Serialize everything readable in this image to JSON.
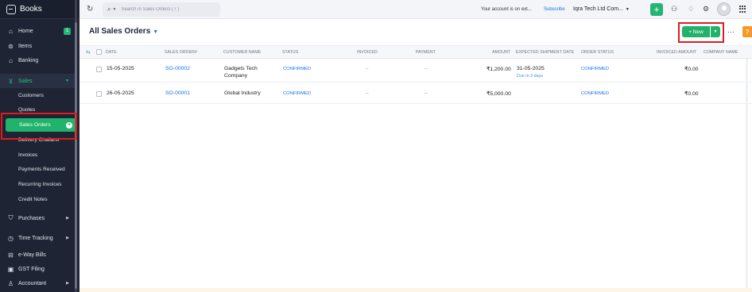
{
  "app": {
    "name": "Books"
  },
  "sidebar": {
    "home": "Home",
    "home_badge": "1",
    "items": "Items",
    "banking": "Banking",
    "sales": "Sales",
    "sales_sub": [
      "Customers",
      "Quotes",
      "Sales Orders",
      "Delivery Challans",
      "Invoices",
      "Payments Received",
      "Recurring Invoices",
      "Credit Notes"
    ],
    "purchases": "Purchases",
    "time_tracking": "Time Tracking",
    "eway_bills": "e-Way Bills",
    "gst_filing": "GST Filing",
    "accountant": "Accountant"
  },
  "topbar": {
    "search_placeholder": "Search in Sales Orders ( / )",
    "account_message": "Your account is on ext...",
    "subscribe": "Subscribe",
    "org_name": "Iqra Tech Ltd Com..."
  },
  "header": {
    "title": "All Sales Orders",
    "new_label": "New",
    "more": "···",
    "help": "?"
  },
  "table": {
    "columns": {
      "date": "DATE",
      "sales_order": "SALES ORDER#",
      "customer": "CUSTOMER NAME",
      "status": "STATUS",
      "invoiced": "INVOICED",
      "payment": "PAYMENT",
      "amount": "AMOUNT",
      "expected_shipment": "EXPECTED SHIPMENT DATE",
      "order_status": "ORDER STATUS",
      "invoiced_amount": "INVOICED AMOUNT",
      "company_name": "COMPANY NAME"
    },
    "rows": [
      {
        "date": "15-05-2025",
        "sales_order": "SO-00002",
        "customer_line1": "Gadgets Tech",
        "customer_line2": "Company",
        "status": "CONFIRMED",
        "invoiced": "–",
        "payment": "–",
        "amount": "₹1,200.00",
        "expected_shipment": "31-05-2025",
        "due_note": "Due in 3 days",
        "order_status": "CONFIRMED",
        "invoiced_amount": "₹0.00"
      },
      {
        "date": "26-05-2025",
        "sales_order": "SO-00001",
        "customer_line1": "Global Industry",
        "customer_line2": "",
        "status": "CONFIRMED",
        "invoiced": "–",
        "payment": "–",
        "amount": "₹5,000.00",
        "expected_shipment": "",
        "due_note": "",
        "order_status": "CONFIRMED",
        "invoiced_amount": "₹0.00"
      }
    ]
  },
  "colors": {
    "sidebar_bg": "#1f2434",
    "accent_green": "#21b26b",
    "link_blue": "#1a73e8",
    "highlight_red": "#e11b1b"
  }
}
